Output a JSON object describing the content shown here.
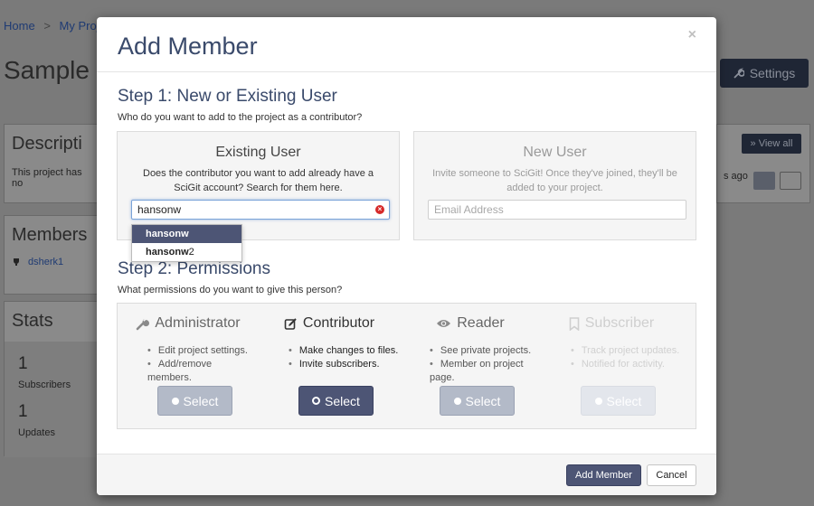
{
  "background": {
    "breadcrumb": {
      "home": "Home",
      "separator": ">",
      "project": "My Projec"
    },
    "page_title": "Sample P",
    "settings_label": "Settings",
    "description_heading": "Descripti",
    "description_text": "This project has no",
    "members_heading": "Members",
    "member_name": "dsherk1",
    "stats_heading": "Stats",
    "stats": [
      {
        "value": "1",
        "label": "Subscribers"
      },
      {
        "value": "1",
        "label": "Updates"
      }
    ],
    "view_all_label": "» View all",
    "ago_text": "s ago"
  },
  "modal": {
    "title": "Add Member",
    "close_label": "×",
    "step1": {
      "title": "Step 1: New or Existing User",
      "subtitle": "Who do you want to add to the project as a contributor?",
      "existing": {
        "title": "Existing User",
        "description": "Does the contributor you want to add already have a SciGit account? Search for them here.",
        "search_value": "hansonw"
      },
      "new": {
        "title": "New User",
        "description": "Invite someone to SciGit! Once they've joined, they'll be added to your project.",
        "email_placeholder": "Email Address"
      },
      "suggestions": [
        {
          "bold": "hansonw",
          "rest": ""
        },
        {
          "bold": "hansonw",
          "rest": "2"
        }
      ]
    },
    "step2": {
      "title": "Step 2: Permissions",
      "subtitle": "What permissions do you want to give this person?",
      "roles": [
        {
          "name": "Administrator",
          "icon": "wrench-icon",
          "perms": [
            "Edit project settings.",
            "Add/remove members."
          ],
          "select_label": "Select",
          "state": "normal"
        },
        {
          "name": "Contributor",
          "icon": "edit-icon",
          "perms": [
            "Make changes to files.",
            "Invite subscribers."
          ],
          "select_label": "Select",
          "state": "selected"
        },
        {
          "name": "Reader",
          "icon": "eye-icon",
          "perms": [
            "See private projects.",
            "Member on project page."
          ],
          "select_label": "Select",
          "state": "normal"
        },
        {
          "name": "Subscriber",
          "icon": "bookmark-icon",
          "perms": [
            "Track project updates.",
            "Notified for activity."
          ],
          "select_label": "Select",
          "state": "disabled"
        }
      ]
    },
    "footer": {
      "add_label": "Add Member",
      "cancel_label": "Cancel"
    }
  },
  "colors": {
    "accent": "#4d5575",
    "title": "#3a4a6b",
    "clear": "#d62a2a"
  }
}
